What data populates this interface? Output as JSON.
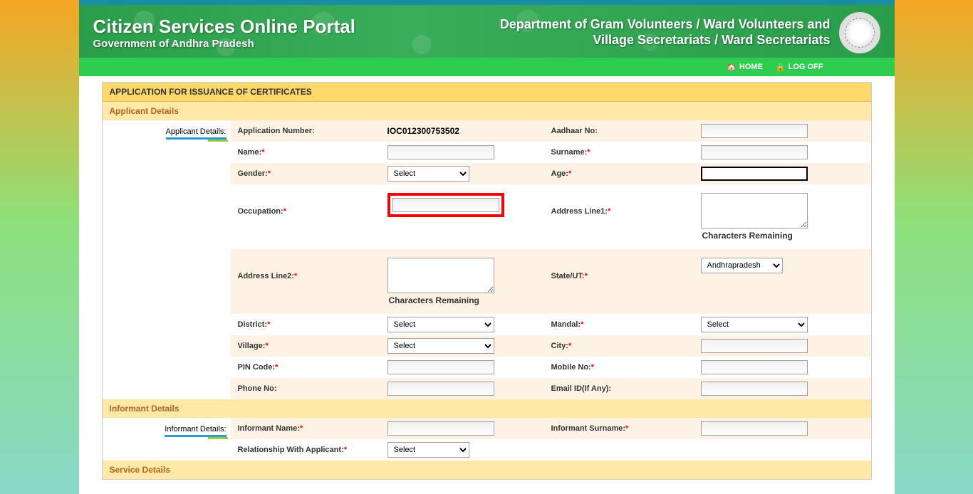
{
  "header": {
    "title": "Citizen Services Online Portal",
    "subtitle": "Government of Andhra Pradesh",
    "dept_line1": "Department of Gram Volunteers / Ward Volunteers and",
    "dept_line2": "Village Secretariats / Ward Secretariats"
  },
  "nav": {
    "home": "HOME",
    "logoff": "LOG OFF"
  },
  "panel": {
    "title": "APPLICATION FOR ISSUANCE OF CERTIFICATES"
  },
  "sections": {
    "applicant": {
      "title": "Applicant Details",
      "tab": "Applicant Details:"
    },
    "informant": {
      "title": "Informant Details",
      "tab": "Informant Details:"
    },
    "service": {
      "title": "Service Details"
    }
  },
  "labels": {
    "app_num": "Application Number:",
    "aadhaar": "Aadhaar No:",
    "name": "Name:",
    "surname": "Surname:",
    "gender": "Gender:",
    "age": "Age:",
    "occupation": "Occupation:",
    "addr1": "Address Line1:",
    "addr2": "Address Line2:",
    "state": "State/UT:",
    "district": "District:",
    "mandal": "Mandal:",
    "village": "Village:",
    "city": "City:",
    "pin": "PIN Code:",
    "mobile": "Mobile No:",
    "phone": "Phone No:",
    "email": "Email ID(If Any):",
    "inf_name": "Informant Name:",
    "inf_surname": "Informant Surname:",
    "relation": "Relationship With Applicant:",
    "chars_rem": "Characters Remaining"
  },
  "values": {
    "app_num": "IOC012300753502",
    "aadhaar": "",
    "name": "",
    "surname": "",
    "gender": "Select",
    "age": "",
    "occupation": "",
    "addr1": "",
    "addr2": "",
    "state": "Andhrapradesh",
    "district": "Select",
    "mandal": "Select",
    "village": "Select",
    "city": "",
    "pin": "",
    "mobile": "",
    "phone": "",
    "email": "",
    "inf_name": "",
    "inf_surname": "",
    "relation": "Select"
  },
  "options": {
    "select_default": "Select",
    "state_default": "Andhrapradesh"
  }
}
